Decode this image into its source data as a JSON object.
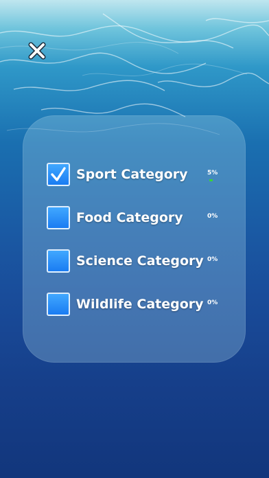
{
  "categories": [
    {
      "label": "Sport Category",
      "percent_text": "5%",
      "progress": 0.05,
      "checked": true
    },
    {
      "label": "Food Category",
      "percent_text": "0%",
      "progress": 0,
      "checked": false
    },
    {
      "label": "Science Category",
      "percent_text": "0%",
      "progress": 0,
      "checked": false
    },
    {
      "label": "Wildlife Category",
      "percent_text": "0%",
      "progress": 0,
      "checked": false
    }
  ],
  "icons": {
    "close": "close-icon",
    "check": "checkmark-icon"
  },
  "colors": {
    "checkbox": "#1a7cf2",
    "progress": "#3ad23a",
    "background_top": "#6fc4dc",
    "background_bottom": "#12367c"
  }
}
